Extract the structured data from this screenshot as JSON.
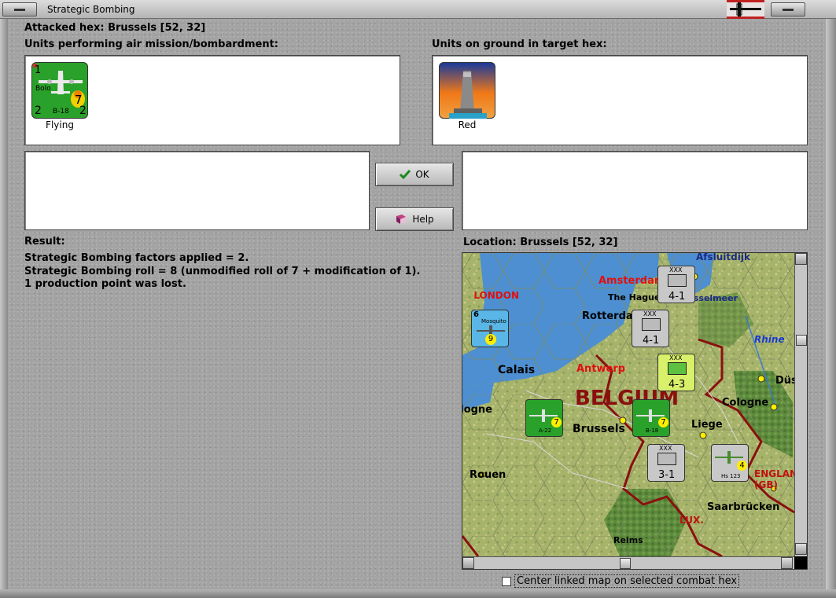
{
  "window": {
    "title": "Strategic Bombing"
  },
  "header": {
    "attacked_hex": "Attacked hex: Brussels  [52, 32]"
  },
  "attackers": {
    "heading": "Units performing air mission/bombardment:",
    "units": [
      {
        "name": "Bolo",
        "type": "B-18",
        "attack": "1",
        "range": "7",
        "left_value": "2",
        "right_value": "2",
        "status": "Flying"
      }
    ]
  },
  "defenders": {
    "heading": "Units on ground in target hex:",
    "units": [
      {
        "status": "Red",
        "icon": "factory-chimney-icon"
      }
    ]
  },
  "buttons": {
    "ok_label": "OK",
    "help_label": "Help"
  },
  "result": {
    "heading": "Result:",
    "lines": [
      "Strategic Bombing factors applied = 2.",
      "Strategic Bombing roll = 8 (unmodified roll of 7 + modification of 1).",
      "1 production point was lost."
    ]
  },
  "location": {
    "heading": "Location:  Brussels  [52, 32]"
  },
  "map": {
    "labels": [
      "Afsluitdijk",
      "Amsterdam",
      "The Hague",
      "IJsselmeer",
      "Rotterdam",
      "Rhine",
      "LONDON",
      "Calais",
      "Antwerp",
      "BELGIUM",
      "Düsseldorf",
      "Cologne",
      "Boulogne",
      "Brussels",
      "Liege",
      "Rouen",
      "LUX.",
      "Saarbrücken",
      "Reims",
      "ENGLAND (GB)"
    ],
    "counters": [
      {
        "corps": "XXX",
        "strength": "4-1"
      },
      {
        "corps": "XXX",
        "strength": "4-1"
      },
      {
        "corps": "XXX",
        "strength": "4-3"
      },
      {
        "corps": "XXX",
        "strength": "3-1"
      },
      {
        "type": "Mosquito",
        "value": "9",
        "top": "6"
      },
      {
        "type": "A-22",
        "value": "7"
      },
      {
        "type": "B-18",
        "value": "7"
      },
      {
        "type": "Hs 123",
        "value": "4"
      }
    ]
  },
  "options": {
    "center_map_label": "Center linked map on selected combat hex",
    "center_map_checked": false
  }
}
